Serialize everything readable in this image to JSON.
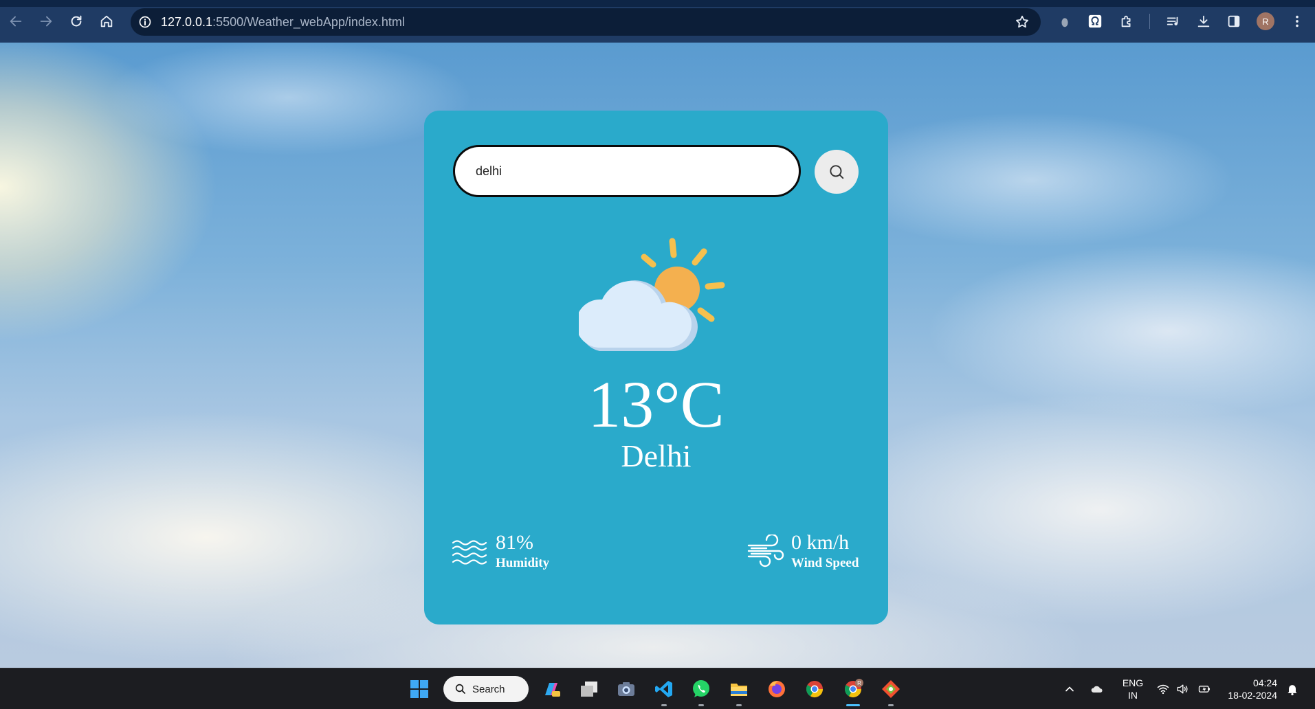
{
  "browser": {
    "url_host": "127.0.0.1",
    "url_rest": ":5500/Weather_webApp/index.html",
    "profile_initial": "R"
  },
  "weather": {
    "search_value": "delhi",
    "temperature": "13°C",
    "city": "Delhi",
    "humidity_value": "81%",
    "humidity_label": "Humidity",
    "wind_value": "0 km/h",
    "wind_label": "Wind Speed",
    "condition_icon": "partly-cloudy-icon",
    "card_color": "#2aaacb"
  },
  "taskbar": {
    "search_label": "Search",
    "lang_line1": "ENG",
    "lang_line2": "IN",
    "time": "04:24",
    "date": "18-02-2024",
    "chrome_badge": "R"
  }
}
